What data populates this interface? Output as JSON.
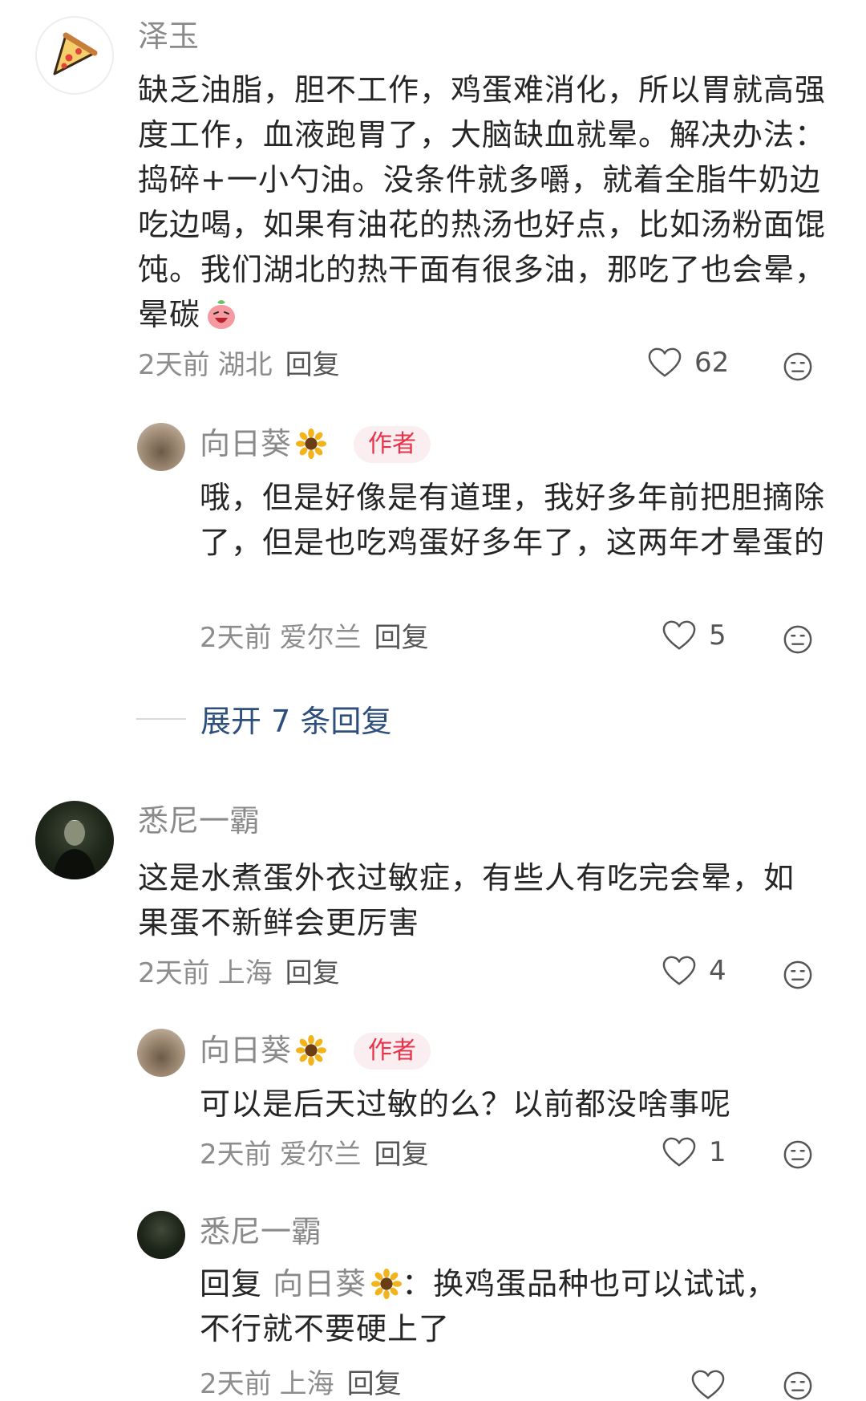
{
  "comments": [
    {
      "username": "泽玉",
      "avatar_icon": "pizza-icon",
      "text": "缺乏油脂，胆不工作，鸡蛋难消化，所以胃就高强度工作，血液跑胃了，大脑缺血就晕。解决办法：捣碎+一小勺油。没条件就多嚼，就着全脂牛奶边吃边喝，如果有油花的热汤也好点，比如汤粉面馄饨。我们湖北的热干面有很多油，那吃了也会晕，晕碳",
      "emoji": "laughing-radish-emoji",
      "time": "2天前",
      "location": "湖北",
      "reply": "回复",
      "likes": "62",
      "replies": [
        {
          "username": "向日葵",
          "avatar_icon": "house-photo",
          "name_emoji": "sunflower-icon",
          "badge": "作者",
          "text": "哦，但是好像是有道理，我好多年前把胆摘除了，但是也吃鸡蛋好多年了，这两年才晕蛋的",
          "time": "2天前",
          "location": "爱尔兰",
          "reply": "回复",
          "likes": "5"
        }
      ],
      "expand_label": "展开 7 条回复"
    },
    {
      "username": "悉尼一霸",
      "avatar_icon": "person-photo",
      "text": "这是水煮蛋外衣过敏症，有些人有吃完会晕，如果蛋不新鲜会更厉害",
      "time": "2天前",
      "location": "上海",
      "reply": "回复",
      "likes": "4",
      "replies": [
        {
          "username": "向日葵",
          "avatar_icon": "house-photo",
          "name_emoji": "sunflower-icon",
          "badge": "作者",
          "text": "可以是后天过敏的么？以前都没啥事呢",
          "time": "2天前",
          "location": "爱尔兰",
          "reply": "回复",
          "likes": "1"
        },
        {
          "username": "悉尼一霸",
          "avatar_icon": "person-photo",
          "reply_prefix": "回复",
          "reply_target": "向日葵",
          "reply_colon": "：",
          "text_line1": "换鸡蛋品种也可以试试，",
          "text_line2": "不行就不要硬上了",
          "time": "2天前",
          "location": "上海",
          "reply": "回复"
        }
      ]
    }
  ],
  "colors": {
    "accent_link": "#2e4f7c",
    "author_badge": "#e8324a",
    "meta_gray": "#8d8d8d"
  }
}
